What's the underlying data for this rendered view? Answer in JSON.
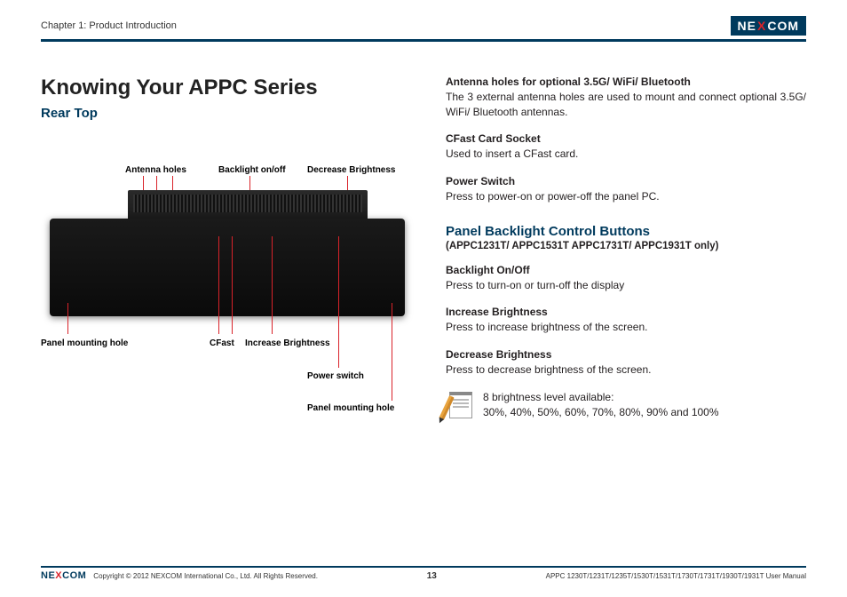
{
  "header": {
    "chapter": "Chapter 1: Product Introduction",
    "logo": "NEXCOM"
  },
  "title": "Knowing Your APPC Series",
  "subtitle": "Rear Top",
  "labels": {
    "antenna_holes": "Antenna holes",
    "backlight_onoff": "Backlight on/off",
    "decrease_brightness": "Decrease Brightness",
    "panel_mounting_hole_left": "Panel mounting hole",
    "cfast": "CFast",
    "increase_brightness": "Increase Brightness",
    "power_switch": "Power switch",
    "panel_mounting_hole_right": "Panel mounting hole"
  },
  "sections": {
    "antenna": {
      "heading": "Antenna holes for optional 3.5G/ WiFi/ Bluetooth",
      "body": "The 3 external antenna holes are used to mount and connect optional 3.5G/ WiFi/ Bluetooth antennas."
    },
    "cfast": {
      "heading": "CFast Card Socket",
      "body": "Used to insert a CFast card."
    },
    "power": {
      "heading": "Power Switch",
      "body": "Press to power-on or power-off the panel PC."
    },
    "panel_section": {
      "heading": "Panel Backlight Control Buttons",
      "subnote": "(APPC1231T/ APPC1531T APPC1731T/ APPC1931T only)"
    },
    "backlight": {
      "heading": "Backlight On/Off",
      "body": "Press to turn-on or turn-off the display"
    },
    "inc": {
      "heading": "Increase Brightness",
      "body": "Press to increase brightness of the screen."
    },
    "dec": {
      "heading": "Decrease Brightness",
      "body": "Press to decrease brightness of the screen."
    },
    "note": {
      "line1": "8 brightness level available:",
      "line2": "30%, 40%, 50%, 60%, 70%, 80%, 90% and 100%"
    }
  },
  "footer": {
    "copyright": "Copyright © 2012 NEXCOM International Co., Ltd. All Rights Reserved.",
    "page": "13",
    "manual": "APPC 1230T/1231T/1235T/1530T/1531T/1730T/1731T/1930T/1931T User Manual"
  }
}
